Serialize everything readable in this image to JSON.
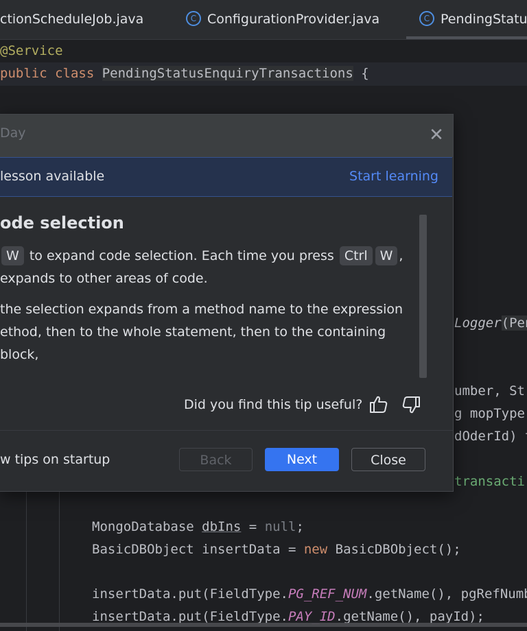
{
  "tabs": [
    {
      "label": "ctionScheduleJob.java",
      "icon": "class-icon"
    },
    {
      "label": "ConfigurationProvider.java",
      "icon": "class-icon"
    },
    {
      "label": "PendingStatus",
      "icon": "class-icon"
    }
  ],
  "tab_icon_glyph": "C",
  "code": {
    "annotation": "@Service",
    "class_kw": "public class",
    "class_name": "PendingStatusEnquiryTransactions",
    "brace": "{",
    "right_fragments": {
      "logger_italic": "Logger",
      "logger_rest": "(Pen",
      "umber": "umber, Str",
      "moptype": "g mopType",
      "dOderId": "dOderId) t",
      "transacti": "transacti"
    },
    "line_mongo_type": "MongoDatabase ",
    "line_mongo_var": "dbIns",
    "line_mongo_eq": " = ",
    "line_mongo_null": "null",
    "line_mongo_end": ";",
    "line_basic_pre": "BasicDBObject insertData = ",
    "line_basic_new": "new",
    "line_basic_post": " BasicDBObject();",
    "line_put1_pre": "insertData.put(FieldType.",
    "line_put1_const": "PG_REF_NUM",
    "line_put1_post": ".getName(), pgRefNumb",
    "line_put2_pre": "insertData.put(FieldType.",
    "line_put2_const": "PAY_ID",
    "line_put2_post": ".getName(), payId);"
  },
  "dialog": {
    "title": "Day",
    "close_glyph": "✕",
    "banner_text": "lesson available",
    "banner_link": "Start learning",
    "tip_title": "ode selection",
    "body": {
      "p1_kbd_w": "W",
      "p1_text1": " to expand code selection. Each time you press ",
      "p1_kbd_ctrl": "Ctrl",
      "p1_kbd_w2": "W",
      "p1_text2": ",",
      "p1_line2": " expands to other areas of code.",
      "p2_line1": " the selection expands from a method name to the expression",
      "p2_line2": "ethod, then to the whole statement, then to the containing block,"
    },
    "feedback_question": "Did you find this tip useful?",
    "show_on_startup": "w tips on startup",
    "back_label": "Back",
    "next_label": "Next",
    "close_label": "Close"
  },
  "colors": {
    "accent": "#3574f0",
    "link": "#548af7",
    "keyword": "#cf8e6d",
    "annotation": "#b3ae60",
    "constant": "#c77dbb"
  }
}
